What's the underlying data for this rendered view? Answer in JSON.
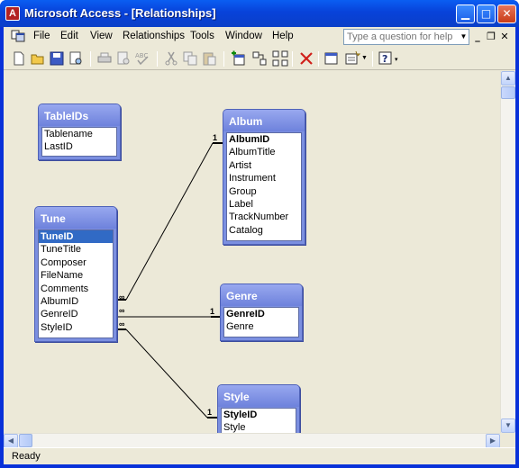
{
  "window": {
    "title": "Microsoft Access - [Relationships]",
    "app_icon_label": "A"
  },
  "menubar": {
    "items": [
      {
        "label": "File"
      },
      {
        "label": "Edit"
      },
      {
        "label": "View"
      },
      {
        "label": "Relationships"
      },
      {
        "label": "Tools"
      },
      {
        "label": "Window"
      },
      {
        "label": "Help"
      }
    ],
    "help_placeholder": "Type a question for help"
  },
  "toolbar": {
    "icons": [
      "new-icon",
      "open-icon",
      "save-icon",
      "print-preview-icon",
      "print-icon",
      "preview-icon",
      "spelling-icon",
      "cut-icon",
      "copy-icon",
      "paste-icon",
      "show-table-icon",
      "show-direct-icon",
      "show-all-icon",
      "delete-icon",
      "database-window-icon",
      "new-object-icon",
      "help-icon"
    ]
  },
  "tables": [
    {
      "name": "TableIDs",
      "fields": [
        {
          "name": "Tablename"
        },
        {
          "name": "LastID"
        }
      ]
    },
    {
      "name": "Album",
      "fields": [
        {
          "name": "AlbumID",
          "key": true
        },
        {
          "name": "AlbumTitle"
        },
        {
          "name": "Artist"
        },
        {
          "name": "Instrument"
        },
        {
          "name": "Group"
        },
        {
          "name": "Label"
        },
        {
          "name": "TrackNumber"
        },
        {
          "name": "Catalog"
        }
      ]
    },
    {
      "name": "Tune",
      "fields": [
        {
          "name": "TuneID",
          "key": true,
          "selected": true
        },
        {
          "name": "TuneTitle"
        },
        {
          "name": "Composer"
        },
        {
          "name": "FileName"
        },
        {
          "name": "Comments"
        },
        {
          "name": "AlbumID"
        },
        {
          "name": "GenreID"
        },
        {
          "name": "StyleID"
        }
      ]
    },
    {
      "name": "Genre",
      "fields": [
        {
          "name": "GenreID",
          "key": true
        },
        {
          "name": "Genre"
        }
      ]
    },
    {
      "name": "Style",
      "fields": [
        {
          "name": "StyleID",
          "key": true
        },
        {
          "name": "Style"
        }
      ]
    }
  ],
  "relationships": [
    {
      "from": "Tune.AlbumID",
      "to": "Album.AlbumID",
      "one_label": "1",
      "many_label": "∞"
    },
    {
      "from": "Tune.GenreID",
      "to": "Genre.GenreID",
      "one_label": "1",
      "many_label": "∞"
    },
    {
      "from": "Tune.StyleID",
      "to": "Style.StyleID",
      "one_label": "1",
      "many_label": "∞"
    }
  ],
  "statusbar": {
    "text": "Ready"
  }
}
